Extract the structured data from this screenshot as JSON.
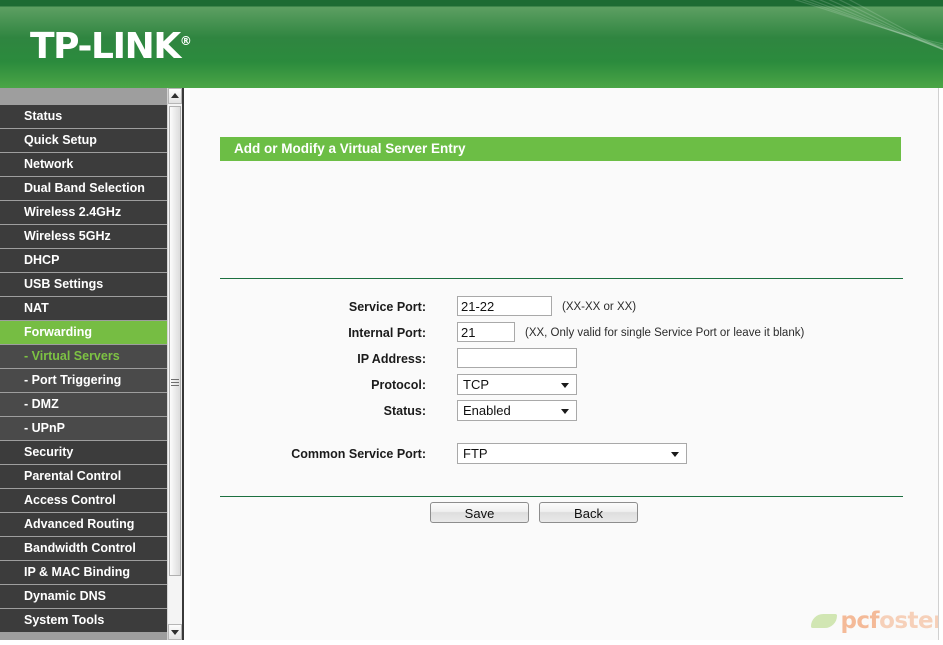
{
  "header": {
    "brand": "TP-LINK",
    "registered_mark": "®"
  },
  "sidebar": {
    "items": [
      {
        "label": "Status",
        "type": "main",
        "state": "normal"
      },
      {
        "label": "Quick Setup",
        "type": "main",
        "state": "normal"
      },
      {
        "label": "Network",
        "type": "main",
        "state": "normal"
      },
      {
        "label": "Dual Band Selection",
        "type": "main",
        "state": "normal"
      },
      {
        "label": "Wireless 2.4GHz",
        "type": "main",
        "state": "normal"
      },
      {
        "label": "Wireless 5GHz",
        "type": "main",
        "state": "normal"
      },
      {
        "label": "DHCP",
        "type": "main",
        "state": "normal"
      },
      {
        "label": "USB Settings",
        "type": "main",
        "state": "normal"
      },
      {
        "label": "NAT",
        "type": "main",
        "state": "normal"
      },
      {
        "label": "Forwarding",
        "type": "main",
        "state": "active"
      },
      {
        "label": "- Virtual Servers",
        "type": "sub",
        "state": "selected"
      },
      {
        "label": "- Port Triggering",
        "type": "sub",
        "state": "normal"
      },
      {
        "label": "- DMZ",
        "type": "sub",
        "state": "normal"
      },
      {
        "label": "- UPnP",
        "type": "sub",
        "state": "normal"
      },
      {
        "label": "Security",
        "type": "main",
        "state": "normal"
      },
      {
        "label": "Parental Control",
        "type": "main",
        "state": "normal"
      },
      {
        "label": "Access Control",
        "type": "main",
        "state": "normal"
      },
      {
        "label": "Advanced Routing",
        "type": "main",
        "state": "normal"
      },
      {
        "label": "Bandwidth Control",
        "type": "main",
        "state": "normal"
      },
      {
        "label": "IP & MAC Binding",
        "type": "main",
        "state": "normal"
      },
      {
        "label": "Dynamic DNS",
        "type": "main",
        "state": "normal"
      },
      {
        "label": "System Tools",
        "type": "main",
        "state": "normal"
      }
    ]
  },
  "panel": {
    "title": "Add or Modify a Virtual Server Entry"
  },
  "form": {
    "service_port": {
      "label": "Service Port:",
      "value": "21-22",
      "placeholder": "",
      "hint": "(XX-XX or XX)"
    },
    "internal_port": {
      "label": "Internal Port:",
      "value": "21",
      "placeholder": "",
      "hint": "(XX, Only valid for single Service Port or leave it blank)"
    },
    "ip_address": {
      "label": "IP Address:",
      "value": "",
      "placeholder": "",
      "hint": ""
    },
    "protocol": {
      "label": "Protocol:",
      "value": "TCP"
    },
    "status": {
      "label": "Status:",
      "value": "Enabled"
    },
    "common_service_port": {
      "label": "Common Service Port:",
      "value": "FTP"
    }
  },
  "buttons": {
    "save": "Save",
    "back": "Back"
  },
  "watermark": {
    "text_primary": "pcf",
    "text_secondary": "oster"
  },
  "colors": {
    "brand_green": "#6cbe45",
    "header_dark_green": "#1d6b33",
    "divider_green": "#1c7040",
    "menu_dark": "#3c3c3c",
    "menu_sub": "#4a4a4a",
    "sidebar_gray": "#9e9e9e",
    "content_bg": "#fafafa"
  }
}
